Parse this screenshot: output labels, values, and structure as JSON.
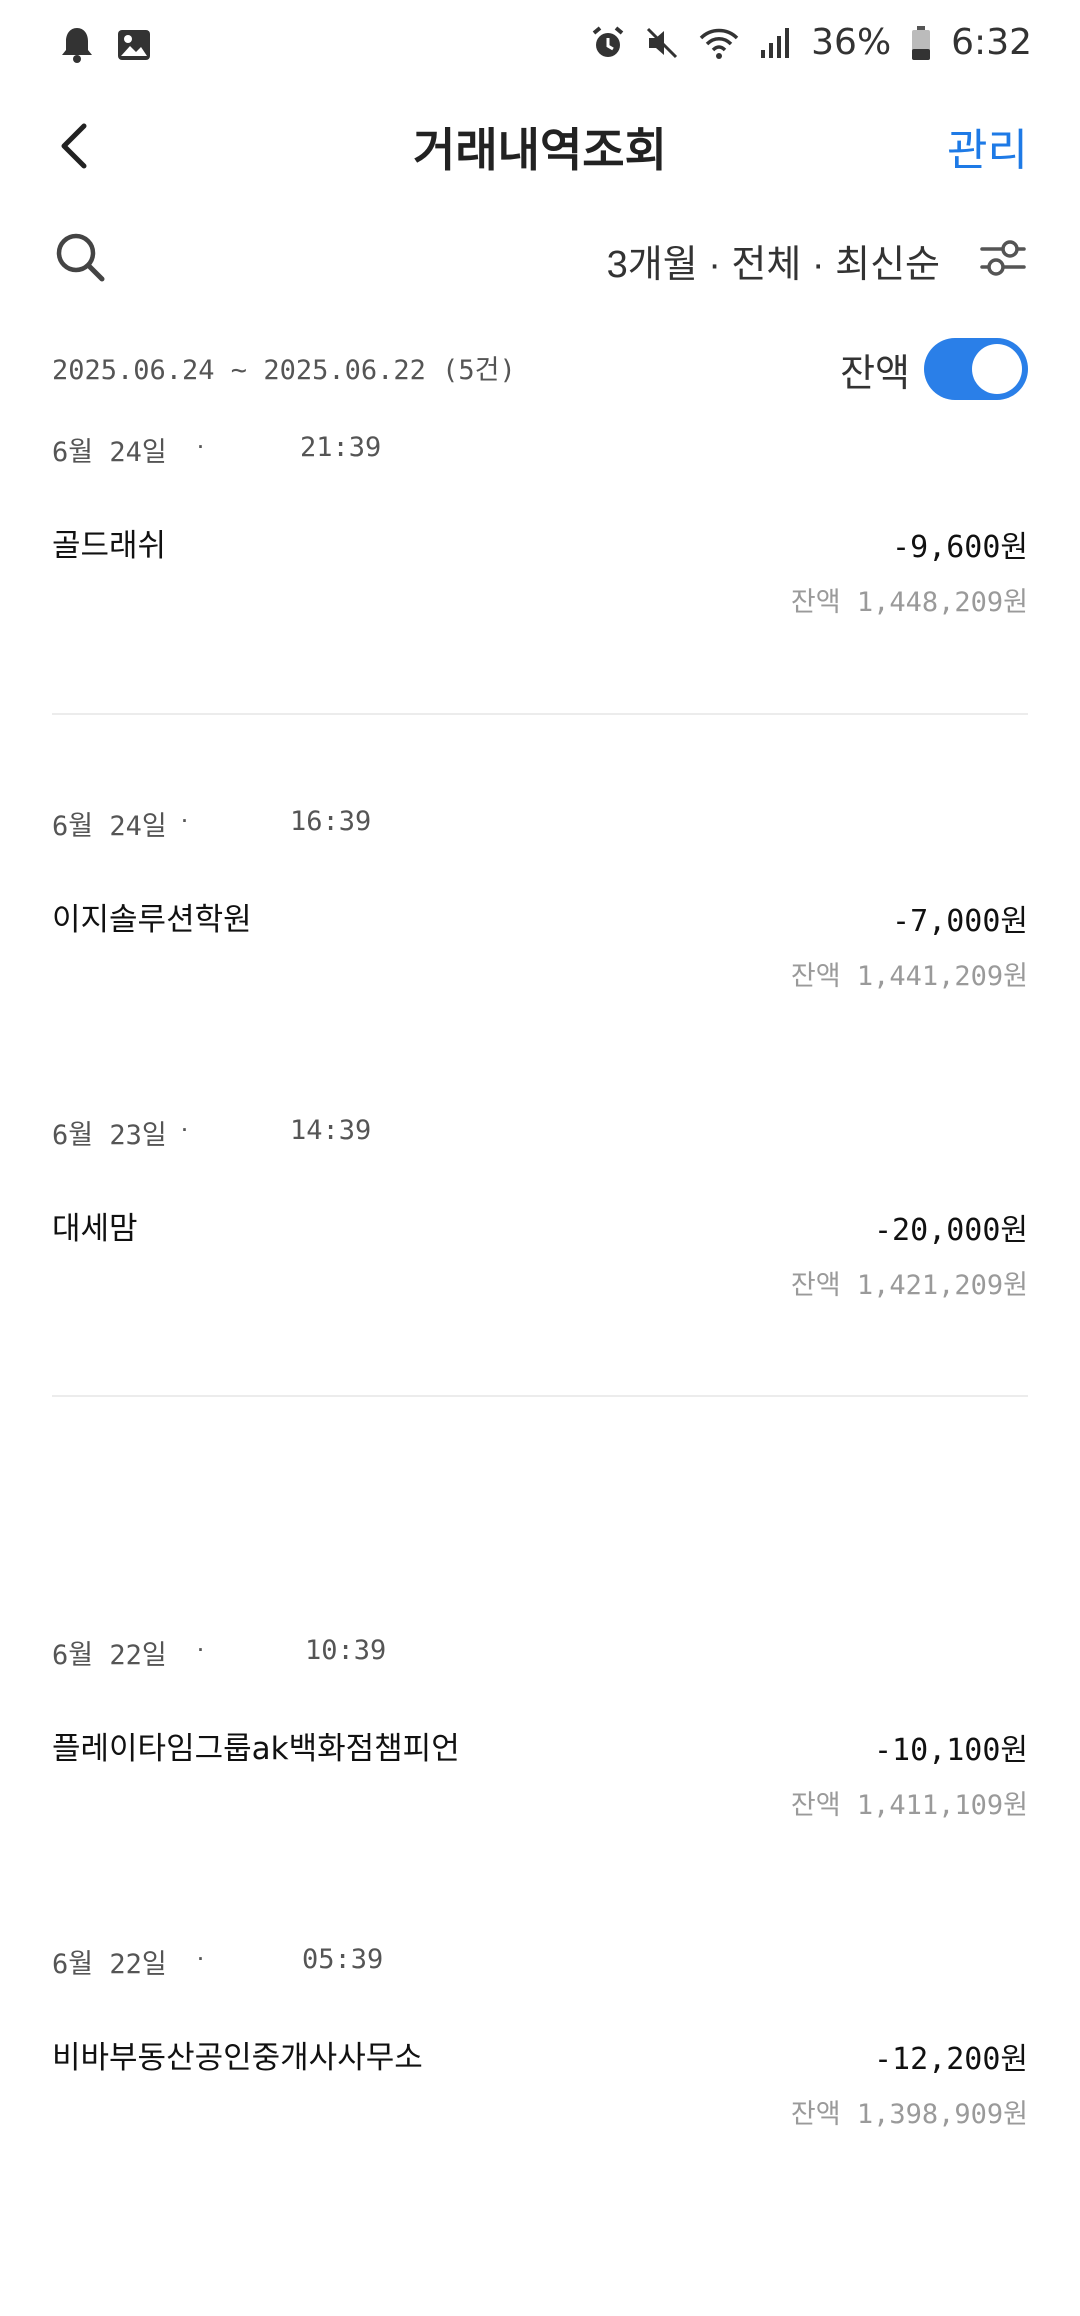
{
  "status_bar": {
    "battery": "36%",
    "time": "6:32",
    "left_icons": [
      "bell-icon",
      "image-icon"
    ],
    "right_icons": [
      "alarm-icon",
      "mute-icon",
      "wifi-icon",
      "signal-icon",
      "battery-icon"
    ]
  },
  "header": {
    "title": "거래내역조회",
    "manage_label": "관리"
  },
  "filter": {
    "summary": "3개월 · 전체 · 최신순"
  },
  "range": {
    "text": "2025.06.24 ~ 2025.06.22 (5건)",
    "balance_label": "잔액",
    "balance_toggle_on": true
  },
  "colors": {
    "accent": "#1e7ae6",
    "toggle": "#2a7fe8"
  },
  "transactions": [
    {
      "date": "6월 24일",
      "time": "21:39",
      "name": "골드래쉬",
      "amount": "-9,600원",
      "balance": "잔액 1,448,209원"
    },
    {
      "date": "6월 24일",
      "time": "16:39",
      "name": "이지솔루션학원",
      "amount": "-7,000원",
      "balance": "잔액 1,441,209원"
    },
    {
      "date": "6월 23일",
      "time": "14:39",
      "name": "대세맘",
      "amount": "-20,000원",
      "balance": "잔액 1,421,209원"
    },
    {
      "date": "6월 22일",
      "time": "10:39",
      "name": "플레이타임그룹ak백화점챔피언",
      "amount": "-10,100원",
      "balance": "잔액 1,411,109원"
    },
    {
      "date": "6월 22일",
      "time": "05:39",
      "name": "비바부동산공인중개사사무소",
      "amount": "-12,200원",
      "balance": "잔액 1,398,909원"
    }
  ]
}
